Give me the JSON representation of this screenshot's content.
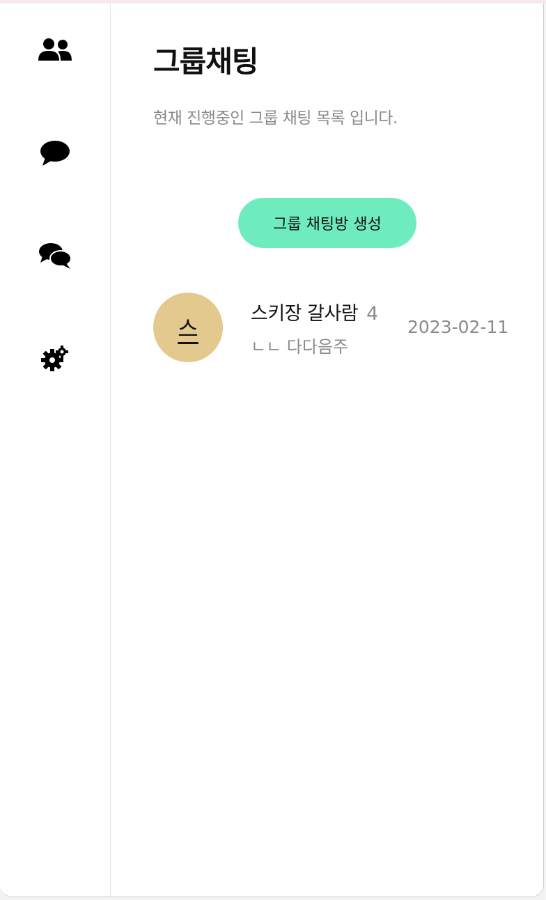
{
  "sidebar": {
    "items": [
      {
        "icon": "users-icon"
      },
      {
        "icon": "chat-bubble-icon"
      },
      {
        "icon": "chat-bubbles-icon"
      },
      {
        "icon": "gear-icon"
      }
    ]
  },
  "header": {
    "title": "그룹채팅",
    "subtitle": "현재 진행중인 그룹 채팅 목록 입니다."
  },
  "actions": {
    "create_label": "그룹 채팅방 생성"
  },
  "rooms": [
    {
      "avatar_initial": "스",
      "name": "스키장 갈사람",
      "member_count": "4",
      "last_message": "ㄴㄴ 다다음주",
      "date": "2023-02-11"
    }
  ],
  "colors": {
    "accent": "#6eecbe",
    "avatar": "#e4c98f",
    "muted_text": "#8a8a8a"
  }
}
